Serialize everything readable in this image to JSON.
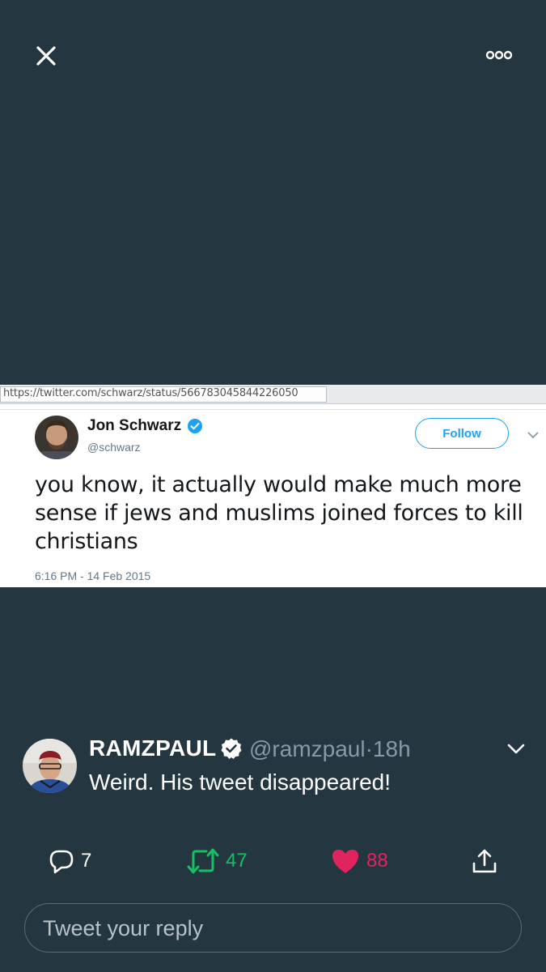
{
  "header": {
    "close_icon": "close-icon",
    "more_icon": "more-options-icon"
  },
  "embedded_screenshot": {
    "url": "https://twitter.com/schwarz/status/566783045844226050",
    "author_name": "Jon Schwarz",
    "author_handle": "@schwarz",
    "follow_label": "Follow",
    "text": "you know, it actually would make much more sense if jews and muslims joined forces to kill christians",
    "timestamp": "6:16 PM - 14 Feb 2015"
  },
  "tweet": {
    "author_name": "RAMZPAUL",
    "author_handle": "@ramzpaul",
    "separator": "·",
    "time": "18h",
    "text": "Weird. His tweet disappeared!"
  },
  "actions": {
    "reply_count": "7",
    "retweet_count": "47",
    "like_count": "88"
  },
  "reply": {
    "placeholder": "Tweet your reply"
  },
  "colors": {
    "background": "#243740",
    "retweet": "#17bf63",
    "like": "#e0245e",
    "link_blue": "#1da1f2"
  }
}
